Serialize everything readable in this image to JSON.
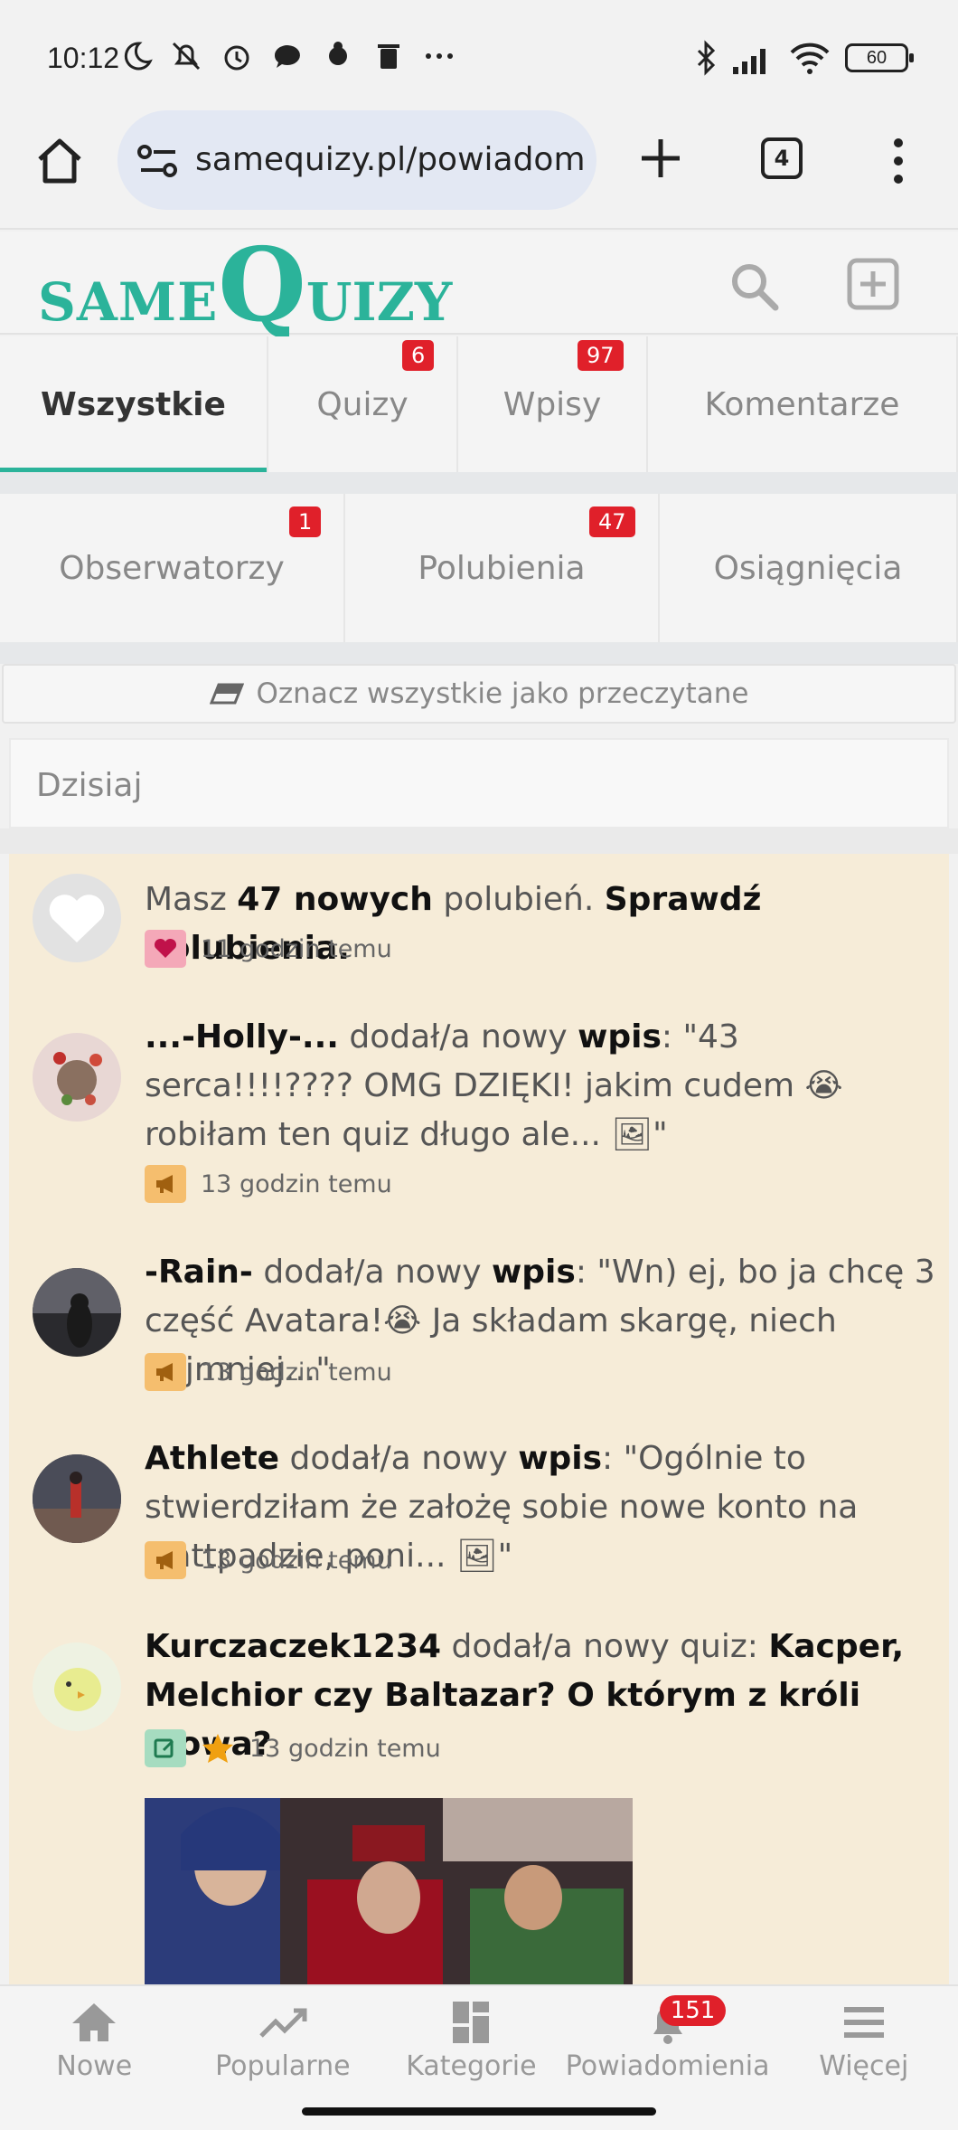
{
  "status_bar": {
    "time": "10:12",
    "battery": "60",
    "left_icons": [
      "moon-icon",
      "bell-off-icon",
      "alarm-icon",
      "chat-icon",
      "bug-icon",
      "trash-icon",
      "more-dots-icon"
    ],
    "right_icons": [
      "bluetooth-icon",
      "signal-icon",
      "wifi-icon",
      "battery-icon"
    ]
  },
  "browser": {
    "url": "samequizy.pl/powiadom",
    "tab_count": "4"
  },
  "header": {
    "logo_same": "SAME",
    "logo_q": "Q",
    "logo_rest": "UIZY"
  },
  "tabs_row1": [
    {
      "label": "Wszystkie",
      "badge": "",
      "active": true
    },
    {
      "label": "Quizy",
      "badge": "6",
      "active": false
    },
    {
      "label": "Wpisy",
      "badge": "97",
      "active": false
    },
    {
      "label": "Komentarze",
      "badge": "",
      "active": false
    }
  ],
  "tabs_row2": [
    {
      "label": "Obserwatorzy",
      "badge": "1"
    },
    {
      "label": "Polubienia",
      "badge": "47"
    },
    {
      "label": "Osiągnięcia",
      "badge": ""
    }
  ],
  "mark_all_read": "Oznacz wszystkie jako przeczytane",
  "section_today": "Dzisiaj",
  "feed": {
    "item1": {
      "pre": "Masz ",
      "count": "47 nowych",
      "mid": " polubień. ",
      "link": "Sprawdź polubienia.",
      "time": "11 godzin temu"
    },
    "item2": {
      "user": "...-Holly-...",
      "action": " dodał/a nowy ",
      "kind": "wpis",
      "text": ": \"43 serca!!!!???? OMG DZIĘKI! jakim cudem 😭 robiłam ten quiz długo ale... 🖼\"",
      "time": "13 godzin temu"
    },
    "item3": {
      "user": "-Rain-",
      "action": " dodał/a nowy ",
      "kind": "wpis",
      "text": ": \"Wn) ej, bo ja chcę 3 część Avatara!😭 Ja składam skargę, niech najmniej...\"",
      "time": "13 godzin temu"
    },
    "item4": {
      "user": "Athlete",
      "action": " dodał/a nowy ",
      "kind": "wpis",
      "text": ": \"Ogólnie to stwierdziłam że założę sobie nowe konto na wattpadzie, poni... 🖼\"",
      "time": "13 godzin temu"
    },
    "item5": {
      "user": "Kurczaczek1234",
      "action": " dodał/a nowy quiz: ",
      "title": "Kacper, Melchior czy Baltazar? O którym z króli mowa?",
      "time": "13 godzin temu"
    }
  },
  "bottom_nav": [
    {
      "label": "Nowe",
      "icon": "home-icon"
    },
    {
      "label": "Popularne",
      "icon": "trending-icon"
    },
    {
      "label": "Kategorie",
      "icon": "grid-icon"
    },
    {
      "label": "Powiadomienia",
      "icon": "bell-icon",
      "badge": "151"
    },
    {
      "label": "Więcej",
      "icon": "menu-icon"
    }
  ],
  "colors": {
    "accent": "#2bb39a",
    "badge": "#e0202a",
    "feed_bg": "#f6ecd8"
  }
}
